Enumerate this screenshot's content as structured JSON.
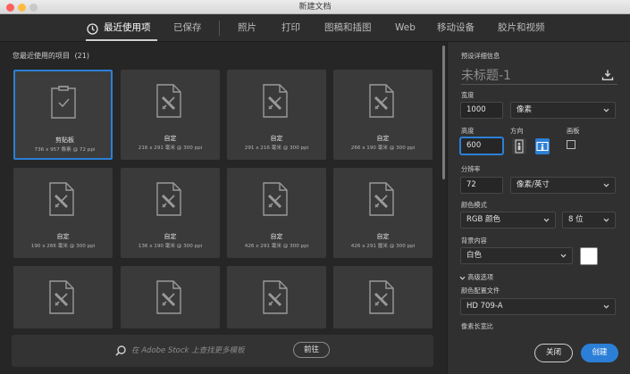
{
  "window": {
    "title": "新建文档"
  },
  "tabs": [
    {
      "label": "最近使用项",
      "active": true,
      "icon": "clock-icon"
    },
    {
      "label": "已保存"
    },
    {
      "label": "照片"
    },
    {
      "label": "打印"
    },
    {
      "label": "图稿和插图"
    },
    {
      "label": "Web"
    },
    {
      "label": "移动设备"
    },
    {
      "label": "胶片和视频"
    }
  ],
  "recent": {
    "heading": "您最近使用的项目",
    "count": "(21)",
    "items": [
      {
        "name": "剪贴板",
        "dims": "736 x 957 像素 @ 72 ppi",
        "icon": "clipboard-doc-icon",
        "selected": true
      },
      {
        "name": "自定",
        "dims": "216 x 291 毫米 @ 300 ppi",
        "icon": "custom-doc-icon"
      },
      {
        "name": "自定",
        "dims": "291 x 216 毫米 @ 300 ppi",
        "icon": "custom-doc-icon"
      },
      {
        "name": "自定",
        "dims": "266 x 190 毫米 @ 300 ppi",
        "icon": "custom-doc-icon"
      },
      {
        "name": "自定",
        "dims": "190 x 266 毫米 @ 300 ppi",
        "icon": "custom-doc-icon"
      },
      {
        "name": "自定",
        "dims": "136 x 190 毫米 @ 300 ppi",
        "icon": "custom-doc-icon"
      },
      {
        "name": "自定",
        "dims": "426 x 291 毫米 @ 300 ppi",
        "icon": "custom-doc-icon"
      },
      {
        "name": "自定",
        "dims": "426 x 291 厘米 @ 300 ppi",
        "icon": "custom-doc-icon"
      },
      {
        "name": "",
        "dims": "",
        "icon": "custom-doc-icon"
      },
      {
        "name": "",
        "dims": "",
        "icon": "custom-doc-icon"
      },
      {
        "name": "",
        "dims": "",
        "icon": "custom-doc-icon"
      },
      {
        "name": "",
        "dims": "",
        "icon": "custom-doc-icon"
      }
    ]
  },
  "stock": {
    "placeholder": "在 Adobe Stock 上查找更多模板",
    "button": "前往"
  },
  "preset": {
    "section_label": "预设详细信息",
    "doc_name": "未标题-1",
    "width_label": "宽度",
    "width_value": "1000",
    "width_unit": "像素",
    "height_label": "高度",
    "height_value": "600",
    "orientation_label": "方向",
    "artboard_label": "画板",
    "resolution_label": "分辨率",
    "resolution_value": "72",
    "resolution_unit": "像素/英寸",
    "color_mode_label": "颜色模式",
    "color_mode_value": "RGB 颜色",
    "bit_depth_value": "8 位",
    "background_label": "背景内容",
    "background_value": "白色",
    "background_color": "#ffffff",
    "advanced_label": "高级选项",
    "color_profile_label": "颜色配置文件",
    "color_profile_value": "HD 709-A",
    "pixel_aspect_label": "像素长宽比"
  },
  "actions": {
    "close": "关闭",
    "create": "创建"
  },
  "colors": {
    "accent": "#2c7fd6",
    "panel": "#303030",
    "background": "#262626",
    "card": "#3a3a3a"
  }
}
